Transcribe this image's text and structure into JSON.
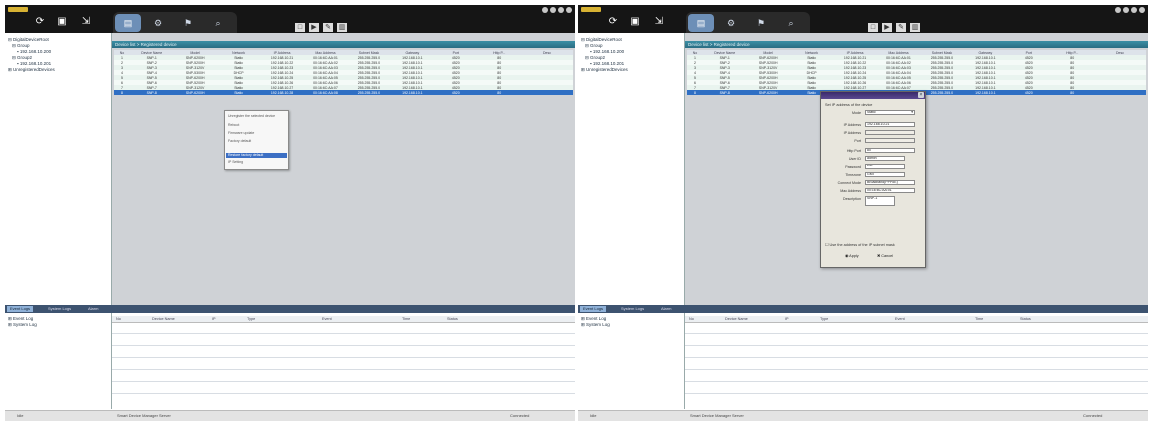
{
  "left_window": {
    "toolbar": {
      "refresh_icon": "refresh-icon",
      "save_icon": "save-icon",
      "export_icon": "export-icon"
    },
    "tabs": [
      "device-tab",
      "tab-2",
      "tab-3",
      "tab-4"
    ],
    "tree": [
      "DigitalDeviceRoot",
      "Group",
      "192.168.10.200",
      "Group2",
      "192.168.10.201",
      "UnregisteredDevices"
    ],
    "breadcrumb": "Device list > Registered device",
    "table": {
      "columns": [
        "No",
        "Device Name",
        "Model",
        "Network",
        "IP Address",
        "Mac Address",
        "Subnet Mask",
        "Gateway",
        "Port",
        "Http P...",
        "Desc"
      ],
      "rows": [
        [
          "1",
          "SNP-1",
          "SNP-6200H",
          "Static",
          "192.168.10.21",
          "00:16:6C:AA:01",
          "255.255.255.0",
          "192.168.10.1",
          "4520",
          "80",
          ""
        ],
        [
          "2",
          "SNP-2",
          "SNP-5200H",
          "Static",
          "192.168.10.22",
          "00:16:6C:AA:02",
          "255.255.255.0",
          "192.168.10.1",
          "4520",
          "80",
          ""
        ],
        [
          "3",
          "SNP-3",
          "SNP-3120V",
          "Static",
          "192.168.10.23",
          "00:16:6C:AA:03",
          "255.255.255.0",
          "192.168.10.1",
          "4520",
          "80",
          ""
        ],
        [
          "4",
          "SNP-4",
          "SNP-5300H",
          "DHCP",
          "192.168.10.24",
          "00:16:6C:AA:04",
          "255.255.255.0",
          "192.168.10.1",
          "4520",
          "80",
          ""
        ],
        [
          "5",
          "SNP-5",
          "SNP-6200H",
          "Static",
          "192.168.10.25",
          "00:16:6C:AA:05",
          "255.255.255.0",
          "192.168.10.1",
          "4520",
          "80",
          ""
        ],
        [
          "6",
          "SNP-6",
          "SNP-5200H",
          "Static",
          "192.168.10.26",
          "00:16:6C:AA:06",
          "255.255.255.0",
          "192.168.10.1",
          "4520",
          "80",
          ""
        ],
        [
          "7",
          "SNP-7",
          "SNP-3120V",
          "Static",
          "192.168.10.27",
          "00:16:6C:AA:07",
          "255.255.255.0",
          "192.168.10.1",
          "4520",
          "80",
          ""
        ],
        [
          "8",
          "SNP-8",
          "SNP-6200H",
          "Static",
          "192.168.10.28",
          "00:16:6C:AA:08",
          "255.255.255.0",
          "192.168.10.1",
          "4520",
          "80",
          ""
        ]
      ]
    },
    "context_menu": {
      "items": [
        "Unregister the selected device",
        "Reboot",
        "Firmware update",
        "Factory default",
        "",
        "Restore factory default",
        "IP Setting"
      ],
      "highlighted_index": 5
    },
    "bottom_tabs": [
      "Event Logs",
      "System Logs",
      "Alarm"
    ],
    "log_tree": [
      "Event Log",
      "System Log"
    ],
    "log_columns": [
      "No",
      "Device Name",
      "IP",
      "Type",
      "Event",
      "Time",
      "Status"
    ],
    "status": {
      "left": "Idle",
      "center": "Smart Device Manager Server",
      "right": "Connected"
    }
  },
  "right_window": {
    "toolbar": {
      "refresh_icon": "refresh-icon",
      "save_icon": "save-icon",
      "export_icon": "export-icon"
    },
    "tabs": [
      "device-tab",
      "tab-2",
      "tab-3",
      "tab-4"
    ],
    "tree": [
      "DigitalDeviceRoot",
      "Group",
      "192.168.10.200",
      "Group2",
      "192.168.10.201",
      "UnregisteredDevices"
    ],
    "breadcrumb": "Device list > Registered device",
    "table": {
      "columns": [
        "No",
        "Device Name",
        "Model",
        "Network",
        "IP Address",
        "Mac Address",
        "Subnet Mask",
        "Gateway",
        "Port",
        "Http P...",
        "Desc"
      ],
      "rows": [
        [
          "1",
          "SNP-1",
          "SNP-6200H",
          "Static",
          "192.168.10.21",
          "00:16:6C:AA:01",
          "255.255.255.0",
          "192.168.10.1",
          "4520",
          "80",
          ""
        ],
        [
          "2",
          "SNP-2",
          "SNP-5200H",
          "Static",
          "192.168.10.22",
          "00:16:6C:AA:02",
          "255.255.255.0",
          "192.168.10.1",
          "4520",
          "80",
          ""
        ],
        [
          "3",
          "SNP-3",
          "SNP-3120V",
          "Static",
          "192.168.10.23",
          "00:16:6C:AA:03",
          "255.255.255.0",
          "192.168.10.1",
          "4520",
          "80",
          ""
        ],
        [
          "4",
          "SNP-4",
          "SNP-5300H",
          "DHCP",
          "192.168.10.24",
          "00:16:6C:AA:04",
          "255.255.255.0",
          "192.168.10.1",
          "4520",
          "80",
          ""
        ],
        [
          "5",
          "SNP-5",
          "SNP-6200H",
          "Static",
          "192.168.10.25",
          "00:16:6C:AA:05",
          "255.255.255.0",
          "192.168.10.1",
          "4520",
          "80",
          ""
        ],
        [
          "6",
          "SNP-6",
          "SNP-5200H",
          "Static",
          "192.168.10.26",
          "00:16:6C:AA:06",
          "255.255.255.0",
          "192.168.10.1",
          "4520",
          "80",
          ""
        ],
        [
          "7",
          "SNP-7",
          "SNP-3120V",
          "Static",
          "192.168.10.27",
          "00:16:6C:AA:07",
          "255.255.255.0",
          "192.168.10.1",
          "4520",
          "80",
          ""
        ],
        [
          "8",
          "SNP-8",
          "SNP-6200H",
          "Static",
          "192.168.10.28",
          "00:16:6C:AA:08",
          "255.255.255.0",
          "192.168.10.1",
          "4520",
          "80",
          ""
        ]
      ]
    },
    "dialog": {
      "description": "Set IP address of the device",
      "mode_label": "Mode",
      "mode_value": "Static",
      "fields": [
        {
          "label": "IP Address",
          "value": "192.168.10.21",
          "disabled": false
        },
        {
          "label": "IP Address",
          "value": "",
          "disabled": true
        },
        {
          "label": "Port",
          "value": "",
          "disabled": true
        },
        {
          "label": "Http Port",
          "value": "80",
          "disabled": false
        },
        {
          "label": "User ID",
          "value": "admin",
          "disabled": false
        },
        {
          "label": "Password",
          "value": "****",
          "disabled": false
        },
        {
          "label": "Timezone",
          "value": "GMT",
          "disabled": false
        },
        {
          "label": "Connect Mode",
          "value": "Broadband(PPPoE)",
          "disabled": false
        },
        {
          "label": "Mac Address",
          "value": "00:16:6C:AA:01",
          "disabled": false
        },
        {
          "label": "Description",
          "value": "SNP-1",
          "disabled": false
        }
      ],
      "checkbox_label": "Use the address of the IP subnet mask",
      "apply_label": "Apply",
      "cancel_label": "Cancel"
    },
    "bottom_tabs": [
      "Event Logs",
      "System Logs",
      "Alarm"
    ],
    "log_tree": [
      "Event Log",
      "System Log"
    ],
    "log_columns": [
      "No",
      "Device Name",
      "IP",
      "Type",
      "Event",
      "Time",
      "Status"
    ],
    "status": {
      "left": "Idle",
      "center": "Smart Device Manager Server",
      "right": "Connected"
    }
  }
}
